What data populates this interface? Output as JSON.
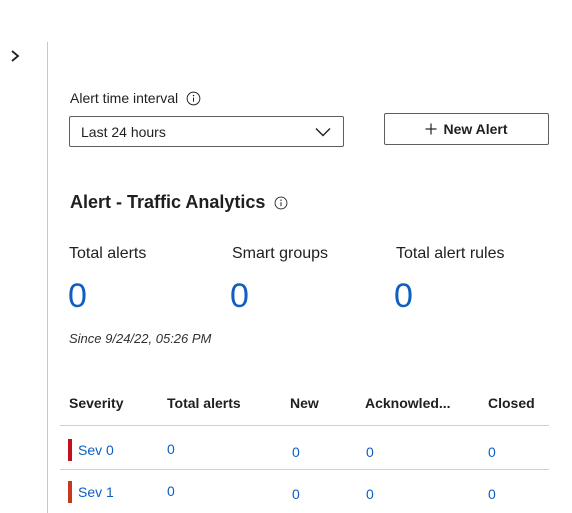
{
  "nav": {
    "expand_icon": "chevron-right-icon"
  },
  "filter": {
    "label": "Alert time interval",
    "selected": "Last 24 hours",
    "info_icon": "info-icon",
    "dropdown_icon": "chevron-down-icon"
  },
  "actions": {
    "new_alert_label": "New Alert",
    "new_alert_icon": "plus-icon"
  },
  "section": {
    "title": "Alert - Traffic Analytics",
    "info_icon": "info-icon"
  },
  "summary": {
    "total_alerts": {
      "label": "Total alerts",
      "value": "0"
    },
    "smart_groups": {
      "label": "Smart groups",
      "value": "0"
    },
    "total_alert_rules": {
      "label": "Total alert rules",
      "value": "0"
    },
    "since": "Since 9/24/22, 05:26 PM"
  },
  "table": {
    "columns": [
      "Severity",
      "Total alerts",
      "New",
      "Acknowled...",
      "Closed"
    ],
    "rows": [
      {
        "severity": "Sev 0",
        "total": "0",
        "new": "0",
        "acknowledged": "0",
        "closed": "0",
        "color": "#c50f1f"
      },
      {
        "severity": "Sev 1",
        "total": "0",
        "new": "0",
        "acknowledged": "0",
        "closed": "0",
        "color": "#c43a1a"
      }
    ]
  },
  "colors": {
    "accent": "#0f5ec0",
    "sev0": "#c50f1f",
    "sev1": "#c43a1a",
    "border": "#605e5c"
  }
}
